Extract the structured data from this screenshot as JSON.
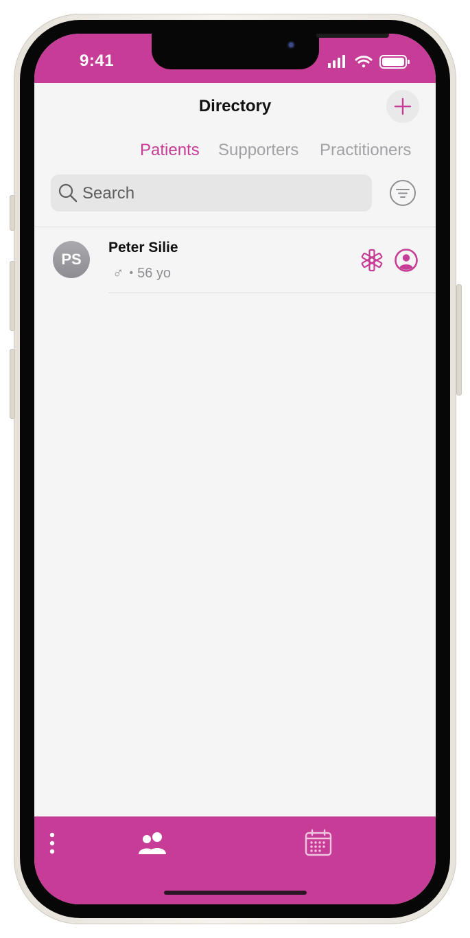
{
  "status_bar": {
    "time": "9:41"
  },
  "header": {
    "title": "Directory",
    "add_icon": "plus-icon"
  },
  "tabs": [
    {
      "label": "Patients",
      "active": true
    },
    {
      "label": "Supporters",
      "active": false
    },
    {
      "label": "Practitioners",
      "active": false
    }
  ],
  "search": {
    "placeholder": "Search",
    "filter_icon": "filter-icon"
  },
  "patients": [
    {
      "initials": "PS",
      "name": "Peter Silie",
      "sex_symbol": "♂",
      "separator": "•",
      "age": "56 yo",
      "icons": [
        "star-of-life-icon",
        "user-circle-icon"
      ]
    }
  ],
  "tab_bar": {
    "items": [
      "more-icon",
      "people-icon",
      "calendar-icon"
    ]
  },
  "colors": {
    "accent": "#c73c96",
    "inactive_tab": "#a1a1a6",
    "background": "#f5f5f5"
  }
}
